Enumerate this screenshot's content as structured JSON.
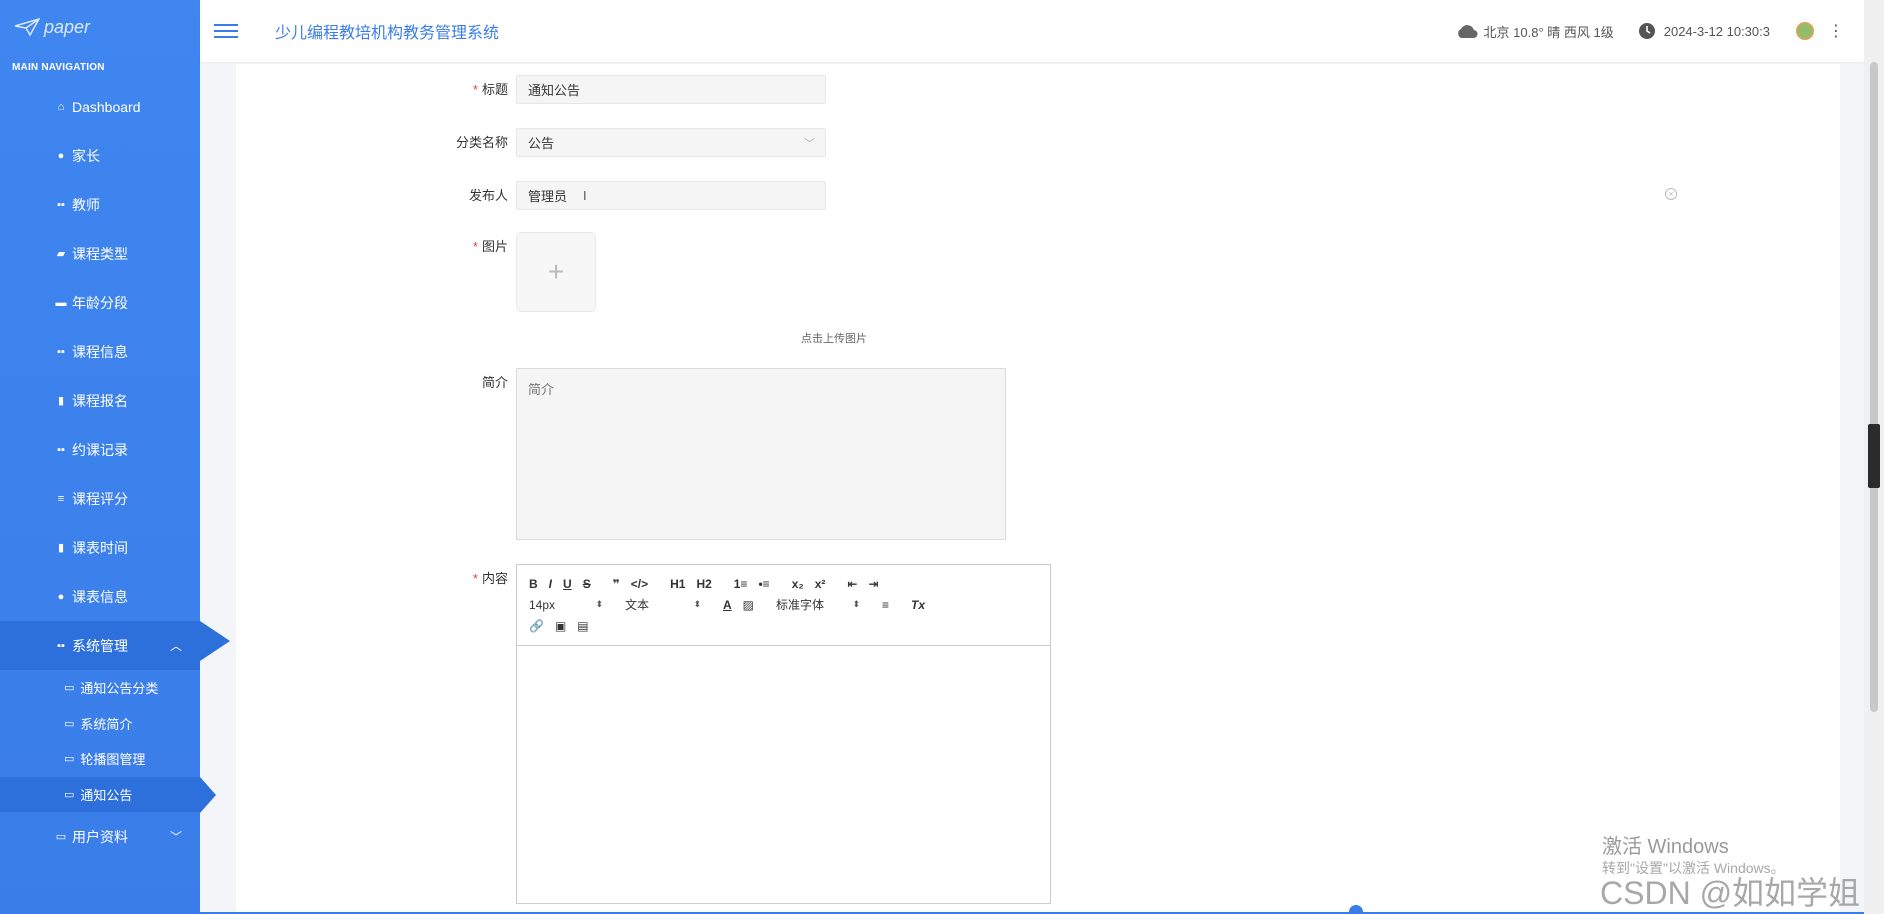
{
  "sidebar": {
    "logo_text": "paper",
    "nav_title": "MAIN NAVIGATION",
    "items": [
      {
        "label": "Dashboard",
        "icon": "home-icon"
      },
      {
        "label": "家长",
        "icon": "map-pin-icon"
      },
      {
        "label": "教师",
        "icon": "grid-icon"
      },
      {
        "label": "课程类型",
        "icon": "thumbs-up-icon"
      },
      {
        "label": "年龄分段",
        "icon": "ticket-icon"
      },
      {
        "label": "课程信息",
        "icon": "grid-icon"
      },
      {
        "label": "课程报名",
        "icon": "bar-chart-icon"
      },
      {
        "label": "约课记录",
        "icon": "grid-icon"
      },
      {
        "label": "课程评分",
        "icon": "list-icon"
      },
      {
        "label": "课表时间",
        "icon": "clipboard-icon"
      },
      {
        "label": "课表信息",
        "icon": "user-icon"
      },
      {
        "label": "系统管理",
        "icon": "grid-icon"
      }
    ],
    "sub_items": [
      {
        "label": "通知公告分类",
        "icon": "folder-icon"
      },
      {
        "label": "系统简介",
        "icon": "folder-icon"
      },
      {
        "label": "轮播图管理",
        "icon": "folder-icon"
      },
      {
        "label": "通知公告",
        "icon": "folder-icon"
      }
    ],
    "user_profile": {
      "label": "用户资料",
      "icon": "id-card-icon"
    }
  },
  "header": {
    "title": "少儿编程教培机构教务管理系统",
    "weather": "北京  10.8°  晴  西风  1级",
    "datetime": "2024-3-12 10:30:3"
  },
  "form": {
    "title_label": "标题",
    "title_value": "通知公告",
    "category_label": "分类名称",
    "category_value": "公告",
    "publisher_label": "发布人",
    "publisher_value": "管理员",
    "image_label": "图片",
    "upload_tip": "点击上传图片",
    "intro_label": "简介",
    "intro_placeholder": "简介",
    "content_label": "内容",
    "required_mark": "*"
  },
  "editor": {
    "row1": [
      "B",
      "I",
      "U",
      "S",
      "❞",
      "</>",
      "H1",
      "H2",
      "1≡",
      "•≡",
      "x₂",
      "x²",
      "⇤",
      "⇥"
    ],
    "font_size": "14px",
    "format": "文本",
    "font_family": "标准字体",
    "clear_format": "Tx"
  },
  "watermark": {
    "line1": "激活 Windows",
    "line2": "转到\"设置\"以激活 Windows。",
    "line3": "CSDN @如如学姐"
  },
  "colors": {
    "accent": "#3a7de8",
    "sidebar_active": "#2d6fdb",
    "required": "#e64242"
  }
}
